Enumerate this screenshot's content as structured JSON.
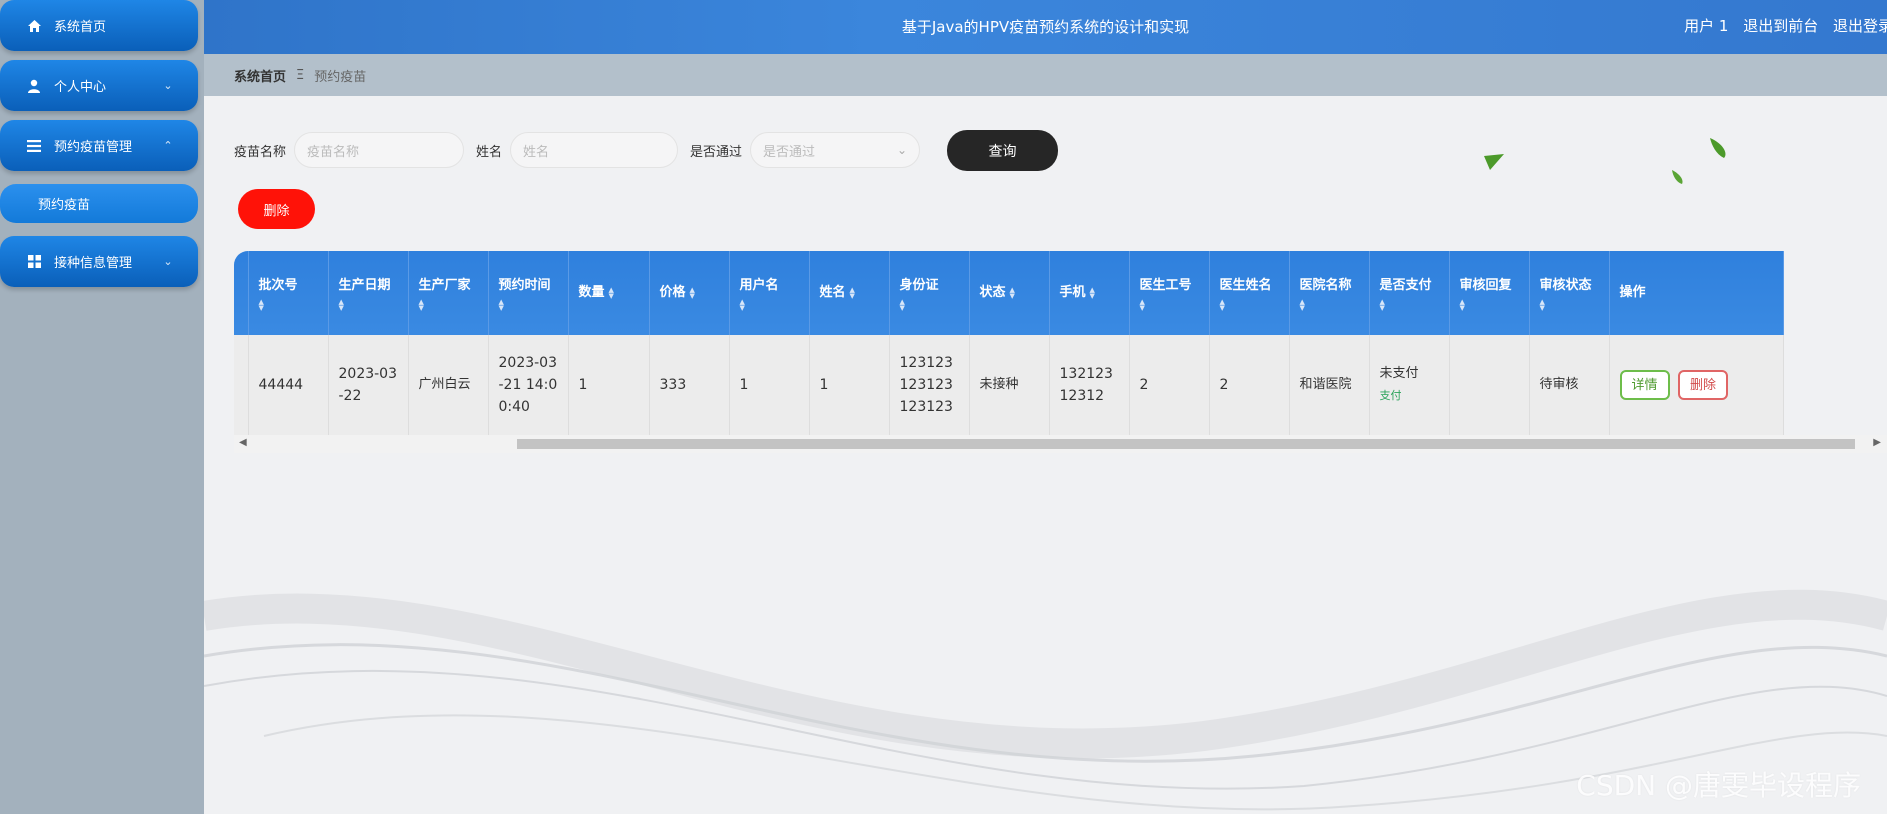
{
  "sidebar": {
    "items": [
      {
        "label": "系统首页",
        "icon": "home-icon"
      },
      {
        "label": "个人中心",
        "icon": "user-icon"
      },
      {
        "label": "预约疫苗管理",
        "icon": "list-icon"
      },
      {
        "label": "接种信息管理",
        "icon": "grid-icon"
      }
    ],
    "sub_item": "预约疫苗"
  },
  "header": {
    "title": "基于Java的HPV疫苗预约系统的设计和实现",
    "user": "用户 1",
    "to_front": "退出到前台",
    "logout": "退出登录"
  },
  "breadcrumb": {
    "home": "系统首页",
    "separator": "Ξ",
    "current": "预约疫苗"
  },
  "search": {
    "vaccine_label": "疫苗名称",
    "vaccine_placeholder": "疫苗名称",
    "name_label": "姓名",
    "name_placeholder": "姓名",
    "pass_label": "是否通过",
    "pass_placeholder": "是否通过",
    "query_button": "查询"
  },
  "delete_button": "删除",
  "table": {
    "columns": [
      "批次号",
      "生产日期",
      "生产厂家",
      "预约时间",
      "数量",
      "价格",
      "用户名",
      "姓名",
      "身份证",
      "状态",
      "手机",
      "医生工号",
      "医生姓名",
      "医院名称",
      "是否支付",
      "审核回复",
      "审核状态",
      "操作"
    ],
    "rows": [
      {
        "batch": "44444",
        "date": "2023-03-22",
        "maker": "广州白云",
        "time": "2023-03-21 14:00:40",
        "qty": "1",
        "price": "333",
        "username": "1",
        "name": "1",
        "idcard": "123123123123123123",
        "status": "未接种",
        "phone": "13212312312",
        "doc_id": "2",
        "doc_name": "2",
        "hospital": "和谐医院",
        "paid": "未支付",
        "pay_link": "支付",
        "reply": "",
        "audit": "待审核",
        "detail_btn": "详情",
        "delete_btn": "删除"
      }
    ]
  },
  "watermark": "CSDN @唐雯毕设程序"
}
